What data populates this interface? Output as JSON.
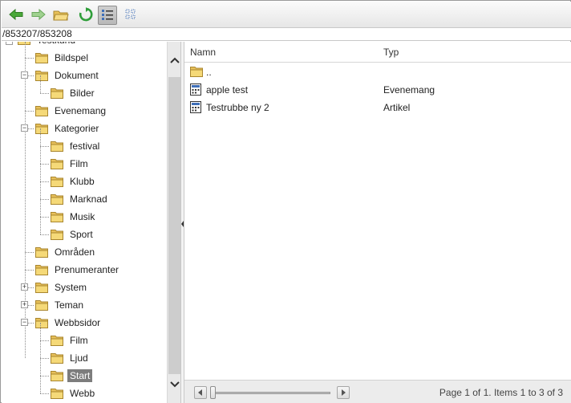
{
  "toolbar": {
    "back_icon": "arrow-left-icon",
    "forward_icon": "arrow-right-icon",
    "up_icon": "folder-up-icon",
    "refresh_icon": "refresh-icon",
    "details_view_icon": "details-view-icon",
    "thumbnails_view_icon": "thumbnails-view-icon",
    "colors": {
      "arrow_green": "#3f9e2f",
      "refresh_green": "#2f9e3a",
      "view_blue": "#3f6fb8"
    }
  },
  "path": {
    "text": "/853207/853208"
  },
  "tree": {
    "root_label": "Testkund",
    "nodes": [
      {
        "label": "Bildspel",
        "level": 1,
        "expander": ""
      },
      {
        "label": "Dokument",
        "level": 1,
        "expander": "−"
      },
      {
        "label": "Bilder",
        "level": 2,
        "expander": ""
      },
      {
        "label": "Evenemang",
        "level": 1,
        "expander": ""
      },
      {
        "label": "Kategorier",
        "level": 1,
        "expander": "−"
      },
      {
        "label": "festival",
        "level": 2,
        "expander": ""
      },
      {
        "label": "Film",
        "level": 2,
        "expander": ""
      },
      {
        "label": "Klubb",
        "level": 2,
        "expander": ""
      },
      {
        "label": "Marknad",
        "level": 2,
        "expander": ""
      },
      {
        "label": "Musik",
        "level": 2,
        "expander": ""
      },
      {
        "label": "Sport",
        "level": 2,
        "expander": ""
      },
      {
        "label": "Områden",
        "level": 1,
        "expander": ""
      },
      {
        "label": "Prenumeranter",
        "level": 1,
        "expander": ""
      },
      {
        "label": "System",
        "level": 1,
        "expander": "+"
      },
      {
        "label": "Teman",
        "level": 1,
        "expander": "+"
      },
      {
        "label": "Webbsidor",
        "level": 1,
        "expander": "−"
      },
      {
        "label": "Film",
        "level": 2,
        "expander": ""
      },
      {
        "label": "Ljud",
        "level": 2,
        "expander": ""
      },
      {
        "label": "Start",
        "level": 2,
        "expander": "",
        "selected": true
      },
      {
        "label": "Webb",
        "level": 2,
        "expander": ""
      }
    ],
    "selected_color": "#7d7d7d"
  },
  "list": {
    "columns": {
      "name": "Namn",
      "type": "Typ"
    },
    "rows": [
      {
        "name": "..",
        "type": "",
        "icon": "folder-icon"
      },
      {
        "name": "apple test",
        "type": "Evenemang",
        "icon": "document-icon"
      },
      {
        "name": "Testrubbe ny 2",
        "type": "Artikel",
        "icon": "document-icon"
      }
    ]
  },
  "footer": {
    "pager_text": "Page 1 of 1. Items 1 to 3 of 3"
  },
  "folder_color": "#f1cf5e"
}
